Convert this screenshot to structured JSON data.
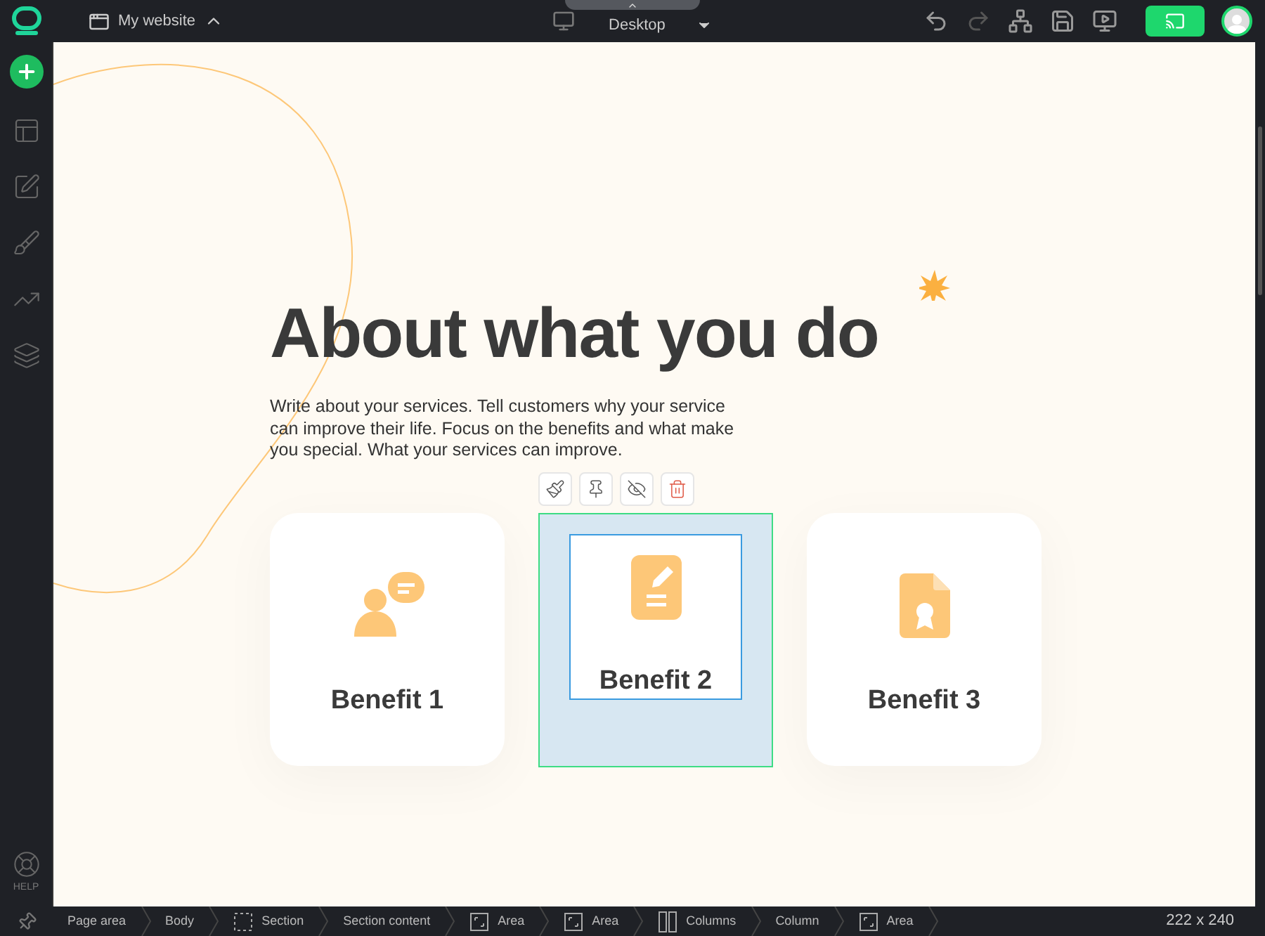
{
  "topbar": {
    "site_name": "My website",
    "device": "Desktop"
  },
  "sidebar": {
    "help_label": "HELP"
  },
  "page": {
    "heading": "About what you do",
    "text": "Write about your services. Tell customers why your service can improve their life. Focus on the benefits and what make you special. What your services can improve.",
    "cards": [
      {
        "title": "Benefit 1",
        "kind": "chat",
        "selected": false
      },
      {
        "title": "Benefit 2",
        "kind": "note",
        "selected": true
      },
      {
        "title": "Benefit 3",
        "kind": "certificate",
        "selected": false
      }
    ]
  },
  "breadcrumbs": [
    {
      "label": "Page area",
      "kind": "plain"
    },
    {
      "label": "Body",
      "kind": "plain"
    },
    {
      "label": "Section",
      "kind": "section"
    },
    {
      "label": "Section content",
      "kind": "plain"
    },
    {
      "label": "Area",
      "kind": "area"
    },
    {
      "label": "Area",
      "kind": "area"
    },
    {
      "label": "Columns",
      "kind": "columns"
    },
    {
      "label": "Column",
      "kind": "plain"
    },
    {
      "label": "Area",
      "kind": "area"
    }
  ],
  "size_readout": "222 x 240"
}
